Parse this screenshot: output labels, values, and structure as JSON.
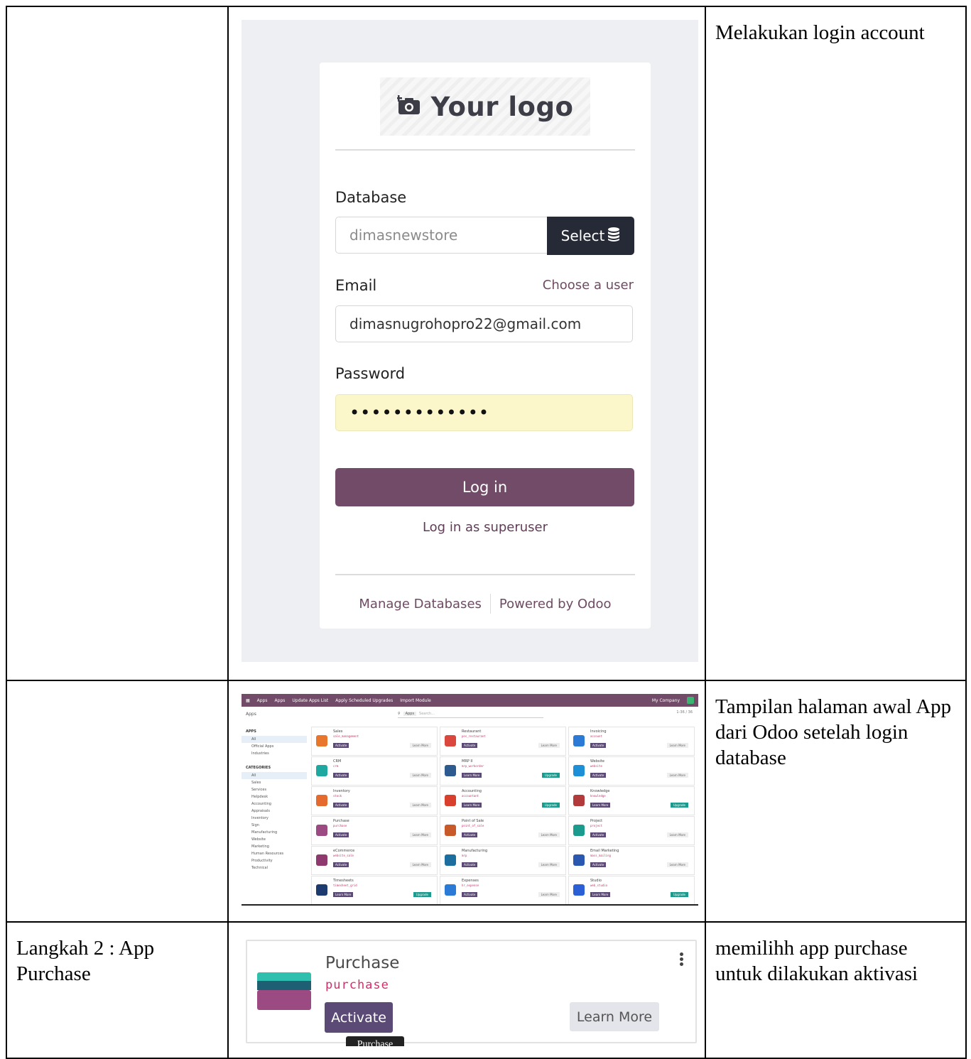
{
  "rows": [
    {
      "step": "",
      "description": "Melakukan login account"
    },
    {
      "step": "",
      "description": "Tampilan halaman awal App dari Odoo setelah login database"
    },
    {
      "step": "Langkah 2 : App Purchase",
      "description": "memilihh app purchase untuk dilakukan aktivasi"
    }
  ],
  "login": {
    "logo_text": "Your logo",
    "database_label": "Database",
    "database_value": "dimasnewstore",
    "select_label": "Select",
    "email_label": "Email",
    "choose_user": "Choose a user",
    "email_value": "dimasnugrohopro22@gmail.com",
    "password_label": "Password",
    "password_value": "•••••••••••••",
    "login_button": "Log in",
    "superuser_link": "Log in as superuser",
    "manage_db": "Manage Databases",
    "powered_by": "Powered by Odoo",
    "colors": {
      "primary": "#714b67",
      "select_bg": "#262a36",
      "password_bg": "#fbf7cb"
    }
  },
  "apps_screen": {
    "menu": [
      "Apps",
      "Apps",
      "Update Apps List",
      "Apply Scheduled Upgrades",
      "Import Module"
    ],
    "company": "My Company",
    "breadcrumb": "Apps",
    "search_chip": "Apps",
    "search_placeholder": "Search...",
    "pager": "1-36 / 36",
    "side_apps_header": "APPS",
    "side_apps": [
      "All",
      "Official Apps",
      "Industries"
    ],
    "side_categories_header": "CATEGORIES",
    "side_categories": [
      "All",
      "Sales",
      "Services",
      "Helpdesk",
      "Accounting",
      "Appraisals",
      "Inventory",
      "Sign",
      "Manufacturing",
      "Website",
      "Marketing",
      "Human Resources",
      "Productivity",
      "Technical"
    ],
    "cards": [
      {
        "name": "Sales",
        "tech": "sale_management",
        "btn": "Activate",
        "right": "Learn More",
        "color": "#e8762c"
      },
      {
        "name": "Restaurant",
        "tech": "pos_restaurant",
        "btn": "Activate",
        "right": "Learn More",
        "color": "#d9473d"
      },
      {
        "name": "Invoicing",
        "tech": "account",
        "btn": "Activate",
        "right": "Learn More",
        "color": "#2b7bd6"
      },
      {
        "name": "CRM",
        "tech": "crm",
        "btn": "Activate",
        "right": "Learn More",
        "color": "#1fa8a0"
      },
      {
        "name": "MRP II",
        "tech": "mrp_workorder",
        "btn": "Learn More",
        "right": "Upgrade",
        "color": "#2d5b8f"
      },
      {
        "name": "Website",
        "tech": "website",
        "btn": "Activate",
        "right": "Learn More",
        "color": "#1c8fd6"
      },
      {
        "name": "Inventory",
        "tech": "stock",
        "btn": "Activate",
        "right": "Learn More",
        "color": "#e56a2d"
      },
      {
        "name": "Accounting",
        "tech": "accountant",
        "btn": "Learn More",
        "right": "Upgrade",
        "color": "#d8402d"
      },
      {
        "name": "Knowledge",
        "tech": "knowledge",
        "btn": "Learn More",
        "right": "Upgrade",
        "color": "#b23a3a"
      },
      {
        "name": "Purchase",
        "tech": "purchase",
        "btn": "Activate",
        "right": "Learn More",
        "color": "#9b4a82"
      },
      {
        "name": "Point of Sale",
        "tech": "point_of_sale",
        "btn": "Activate",
        "right": "Learn More",
        "color": "#c85a2a"
      },
      {
        "name": "Project",
        "tech": "project",
        "btn": "Activate",
        "right": "Learn More",
        "color": "#1a9b8e"
      },
      {
        "name": "eCommerce",
        "tech": "website_sale",
        "btn": "Activate",
        "right": "Learn More",
        "color": "#8e3a6e"
      },
      {
        "name": "Manufacturing",
        "tech": "mrp",
        "btn": "Activate",
        "right": "Learn More",
        "color": "#1c6e9e"
      },
      {
        "name": "Email Marketing",
        "tech": "mass_mailing",
        "btn": "Activate",
        "right": "Learn More",
        "color": "#2a57b0"
      },
      {
        "name": "Timesheets",
        "tech": "timesheet_grid",
        "btn": "Learn More",
        "right": "Upgrade",
        "color": "#1d3b6e"
      },
      {
        "name": "Expenses",
        "tech": "hr_expense",
        "btn": "Activate",
        "right": "Learn More",
        "color": "#2b7bd6"
      },
      {
        "name": "Studio",
        "tech": "web_studio",
        "btn": "Learn More",
        "right": "Upgrade",
        "color": "#2b5fd6"
      }
    ]
  },
  "purchase_card": {
    "name": "Purchase",
    "tech": "purchase",
    "activate": "Activate",
    "learn_more": "Learn More",
    "tooltip": "Purchase"
  }
}
